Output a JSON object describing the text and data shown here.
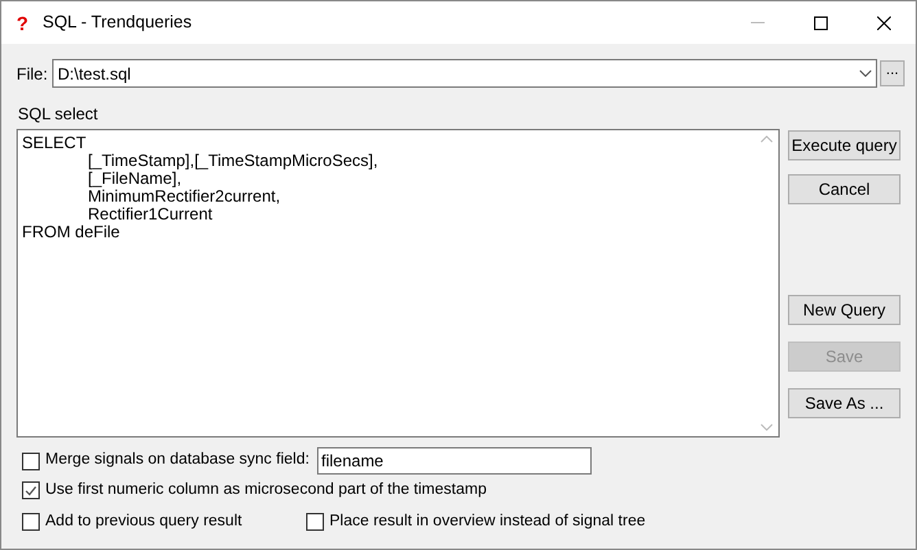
{
  "window": {
    "icon": "?",
    "title": "SQL - Trendqueries"
  },
  "file": {
    "label": "File:",
    "value": "D:\\test.sql",
    "browse": "..."
  },
  "sql": {
    "label": "SQL select",
    "value": "SELECT\n\t\t[_TimeStamp],[_TimeStampMicroSecs],\n\t\t[_FileName],\n\t\tMinimumRectifier2current,\n\t\tRectifier1Current\nFROM deFile"
  },
  "query_buttons": [
    {
      "label": "Execute query",
      "disabled": false
    },
    {
      "label": "Cancel",
      "disabled": false
    }
  ],
  "file_buttons": [
    {
      "label": "New Query",
      "disabled": false
    },
    {
      "label": "Save",
      "disabled": true
    },
    {
      "label": "Save As ...",
      "disabled": false
    }
  ],
  "merge": {
    "label": "Merge signals on database sync field:",
    "checked": false,
    "field_value": "filename"
  },
  "options": [
    {
      "label": "Use first numeric column as microsecond part of the timestamp",
      "checked": true
    },
    {
      "label": "Add to previous query result",
      "checked": false
    },
    {
      "label": "Place result in overview instead of signal tree",
      "checked": false
    }
  ]
}
